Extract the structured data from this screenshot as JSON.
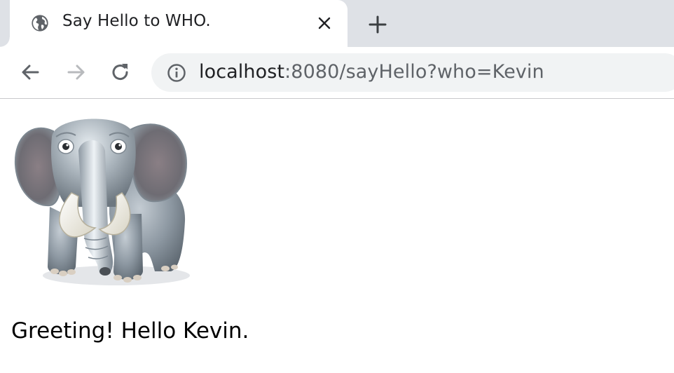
{
  "tab": {
    "title": "Say Hello to WHO.",
    "favicon": "globe-icon"
  },
  "toolbar": {
    "back_icon": "arrow-left-icon",
    "forward_icon": "arrow-right-icon",
    "reload_icon": "reload-icon",
    "info_icon": "info-icon",
    "url_host": "localhost",
    "url_rest": ":8080/sayHello?who=Kevin"
  },
  "page": {
    "image": "elephant-image",
    "greeting": "Greeting! Hello Kevin."
  },
  "colors": {
    "tabstrip_bg": "#dee1e6",
    "omnibox_bg": "#f1f3f4",
    "icon": "#5f6368",
    "icon_disabled": "#b8babd"
  }
}
